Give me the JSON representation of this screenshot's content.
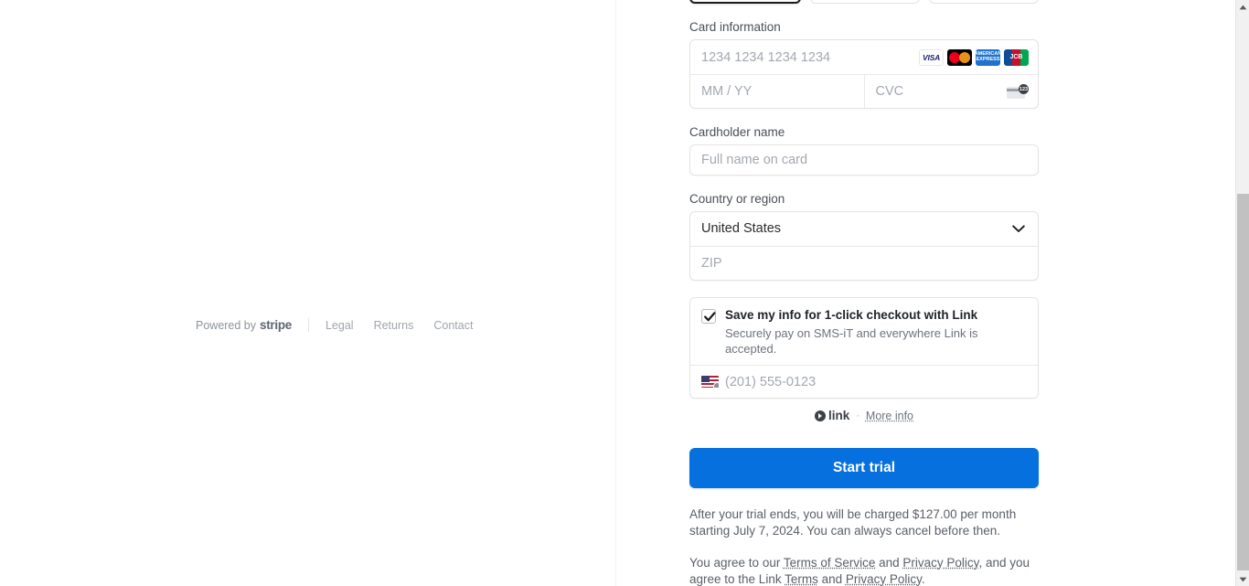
{
  "footer": {
    "powered_prefix": "Powered by",
    "brand": "stripe",
    "links": [
      {
        "label": "Legal"
      },
      {
        "label": "Returns"
      },
      {
        "label": "Contact"
      }
    ]
  },
  "payment_tabs": [
    {
      "name": "card",
      "selected": true
    },
    {
      "name": "alt-method-2",
      "selected": false
    },
    {
      "name": "alt-method-3",
      "selected": false
    }
  ],
  "card_information": {
    "label": "Card information",
    "number_placeholder": "1234 1234 1234 1234",
    "number_value": "",
    "expiry_placeholder": "MM / YY",
    "expiry_value": "",
    "cvc_placeholder": "CVC",
    "cvc_value": "",
    "cvc_hint_digits": "123",
    "brands": [
      {
        "name": "visa-icon",
        "text": "VISA"
      },
      {
        "name": "mastercard-icon",
        "text": ""
      },
      {
        "name": "amex-icon",
        "text": "AMERICAN EXPRESS"
      },
      {
        "name": "jcb-icon",
        "text": "JCB"
      }
    ]
  },
  "cardholder": {
    "label": "Cardholder name",
    "placeholder": "Full name on card",
    "value": ""
  },
  "country": {
    "label": "Country or region",
    "selected": "United States",
    "zip_placeholder": "ZIP",
    "zip_value": ""
  },
  "link_save": {
    "checked": true,
    "title": "Save my info for 1-click checkout with Link",
    "subtitle": "Securely pay on SMS-iT and everywhere Link is accepted.",
    "phone_placeholder": "(201) 555-0123",
    "phone_value": "",
    "country_flag": "us-flag-icon",
    "badge_label": "link",
    "separator": "·",
    "more_info_label": "More info"
  },
  "submit": {
    "label": "Start trial",
    "color": "#0570de"
  },
  "trial_note": "After your trial ends, you will be charged $127.00 per month starting July 7, 2024. You can always cancel before then.",
  "legal": {
    "part1": "You agree to our ",
    "terms_of_service": "Terms of Service",
    "part2": " and ",
    "privacy_policy": "Privacy Policy",
    "part3": ", and you agree to the Link ",
    "link_terms": "Terms",
    "part4": " and ",
    "link_privacy": "Privacy Policy",
    "part5": "."
  },
  "scrollbar": {
    "up_arrow": "▲",
    "down_arrow": "▼"
  }
}
